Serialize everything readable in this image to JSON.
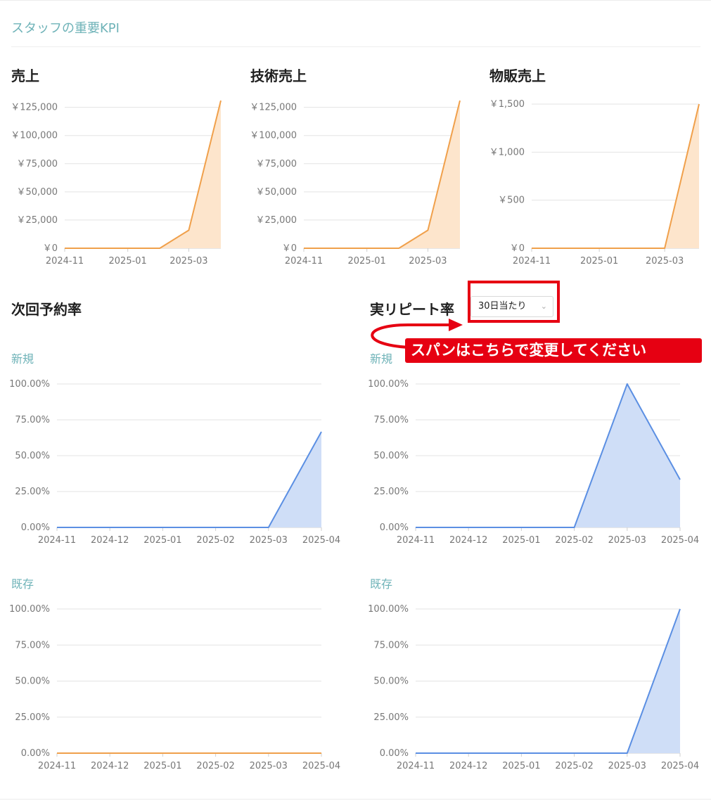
{
  "page": {
    "title": "スタッフの重要KPI"
  },
  "sections": {
    "sales": "売上",
    "tech_sales": "技術売上",
    "retail_sales": "物販売上",
    "next_booking": "次回予約率",
    "repeat": "実リピート率"
  },
  "subtitles": {
    "new": "新規",
    "existing": "既存"
  },
  "span_select": {
    "value": "30日当たり"
  },
  "annotation": {
    "text": "スパンはこちらで変更してください"
  },
  "colors": {
    "orange": "#f0a04b",
    "orange_fill": "#fde5cc",
    "blue": "#5b8fe3",
    "blue_fill": "#cfdef7",
    "accent": "#6fb3b8",
    "red": "#e60012"
  },
  "icons": {
    "dropdown": "chevron-down-icon",
    "arrow": "curved-arrow-icon"
  },
  "chart_data": [
    {
      "id": "sales",
      "type": "area",
      "title": "売上",
      "x": [
        "2024-11-01",
        "2024-12-01",
        "2025-01-01",
        "2025-02-01",
        "2025-03-01",
        "2025-04-01"
      ],
      "x_ticks": [
        "2024-11",
        "2025-01",
        "2025-03"
      ],
      "series": [
        {
          "values": [
            0,
            0,
            0,
            0,
            16000,
            131000
          ]
        }
      ],
      "ylim": [
        0,
        131000
      ],
      "y_ticks": [
        0,
        25000,
        50000,
        75000,
        100000,
        125000
      ],
      "y_tick_labels": [
        "￥0",
        "￥25,000",
        "￥50,000",
        "￥75,000",
        "￥100,000",
        "￥125,000"
      ],
      "grid": true,
      "color": "orange"
    },
    {
      "id": "tech_sales",
      "type": "area",
      "title": "技術売上",
      "x": [
        "2024-11-01",
        "2024-12-01",
        "2025-01-01",
        "2025-02-01",
        "2025-03-01",
        "2025-04-01"
      ],
      "x_ticks": [
        "2024-11",
        "2025-01",
        "2025-03"
      ],
      "series": [
        {
          "values": [
            0,
            0,
            0,
            0,
            16000,
            131000
          ]
        }
      ],
      "ylim": [
        0,
        131000
      ],
      "y_ticks": [
        0,
        25000,
        50000,
        75000,
        100000,
        125000
      ],
      "y_tick_labels": [
        "￥0",
        "￥25,000",
        "￥50,000",
        "￥75,000",
        "￥100,000",
        "￥125,000"
      ],
      "grid": true,
      "color": "orange"
    },
    {
      "id": "retail_sales",
      "type": "area",
      "title": "物販売上",
      "x": [
        "2024-11-01",
        "2024-12-01",
        "2025-01-01",
        "2025-02-01",
        "2025-03-01",
        "2025-04-01"
      ],
      "x_ticks": [
        "2024-11",
        "2025-01",
        "2025-03"
      ],
      "series": [
        {
          "values": [
            0,
            0,
            0,
            0,
            0,
            1500
          ]
        }
      ],
      "ylim": [
        0,
        1500
      ],
      "y_ticks": [
        0,
        500,
        1000,
        1500
      ],
      "y_tick_labels": [
        "￥0",
        "￥500",
        "￥1,000",
        "￥1,500"
      ],
      "grid": true,
      "color": "orange"
    },
    {
      "id": "next_new",
      "type": "area",
      "title": "新規",
      "x_ticks": [
        "2024-11",
        "2024-12",
        "2025-01",
        "2025-02",
        "2025-03",
        "2025-04"
      ],
      "series": [
        {
          "values": [
            0,
            0,
            0,
            0,
            0,
            66.67
          ]
        }
      ],
      "ylim": [
        0,
        100
      ],
      "y_ticks": [
        0,
        25,
        50,
        75,
        100
      ],
      "y_tick_labels": [
        "0.00%",
        "25.00%",
        "50.00%",
        "75.00%",
        "100.00%"
      ],
      "grid": true,
      "color": "blue"
    },
    {
      "id": "repeat_new",
      "type": "area",
      "title": "新規",
      "x_ticks": [
        "2024-11",
        "2024-12",
        "2025-01",
        "2025-02",
        "2025-03",
        "2025-04"
      ],
      "series": [
        {
          "values": [
            0,
            0,
            0,
            0,
            100,
            33.33
          ]
        }
      ],
      "ylim": [
        0,
        100
      ],
      "y_ticks": [
        0,
        25,
        50,
        75,
        100
      ],
      "y_tick_labels": [
        "0.00%",
        "25.00%",
        "50.00%",
        "75.00%",
        "100.00%"
      ],
      "grid": true,
      "color": "blue"
    },
    {
      "id": "next_existing",
      "type": "line",
      "title": "既存",
      "x_ticks": [
        "2024-11",
        "2024-12",
        "2025-01",
        "2025-02",
        "2025-03",
        "2025-04"
      ],
      "series": [
        {
          "values": [
            0,
            0,
            0,
            0,
            0,
            0
          ]
        }
      ],
      "ylim": [
        0,
        100
      ],
      "y_ticks": [
        0,
        25,
        50,
        75,
        100
      ],
      "y_tick_labels": [
        "0.00%",
        "25.00%",
        "50.00%",
        "75.00%",
        "100.00%"
      ],
      "grid": true,
      "color": "orange"
    },
    {
      "id": "repeat_existing",
      "type": "area",
      "title": "既存",
      "x_ticks": [
        "2024-11",
        "2024-12",
        "2025-01",
        "2025-02",
        "2025-03",
        "2025-04"
      ],
      "series": [
        {
          "values": [
            0,
            0,
            0,
            0,
            0,
            100
          ]
        }
      ],
      "ylim": [
        0,
        100
      ],
      "y_ticks": [
        0,
        25,
        50,
        75,
        100
      ],
      "y_tick_labels": [
        "0.00%",
        "25.00%",
        "50.00%",
        "75.00%",
        "100.00%"
      ],
      "grid": true,
      "color": "blue"
    }
  ]
}
